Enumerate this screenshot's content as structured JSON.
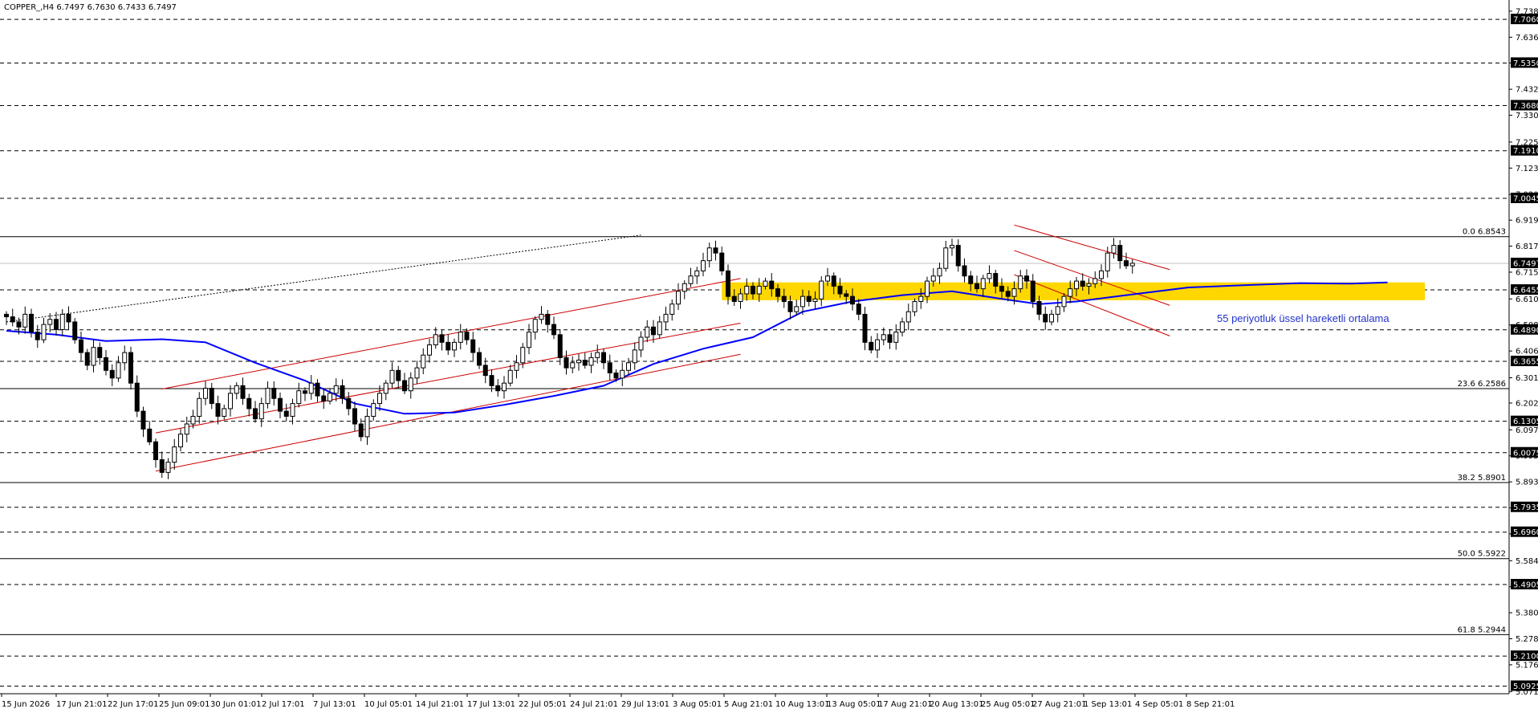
{
  "header": {
    "symbol_info": "COPPER_,H4  6.7497 6.7630 6.7433 6.7497"
  },
  "annotation": {
    "text": "55 periyotluk üssel hareketli ortalama",
    "color": "#2233cc"
  },
  "colors": {
    "candle": "#000000",
    "ema": "#0000ff",
    "channel": "#cc0000",
    "zone": "#ffd700",
    "hline": "#000000",
    "current_price_line": "#c0c0c0",
    "badge_bg": "#000000",
    "badge_text": "#ffffff"
  },
  "chart_data": {
    "type": "candlestick",
    "symbol": "COPPER_",
    "timeframe": "H4",
    "ohlc_header": {
      "open": 6.7497,
      "high": 6.763,
      "low": 6.7433,
      "close": 6.7497
    },
    "ylim": [
      5.0625,
      7.763
    ],
    "y_ticks": [
      "7.7380",
      "7.6360",
      "7.5350",
      "7.4320",
      "7.3300",
      "7.2250",
      "7.1230",
      "7.0200",
      "6.9190",
      "6.8170",
      "6.7150",
      "6.6100",
      "6.5080",
      "6.4060",
      "6.3010",
      "6.2020",
      "6.0970",
      "5.9950",
      "5.8930",
      "5.7910",
      "5.6890",
      "5.5840",
      "5.4820",
      "5.3800",
      "5.2780",
      "5.1760",
      "5.0710"
    ],
    "x_labels": [
      "15 Jun 2026",
      "17 Jun 21:01",
      "22 Jun 17:01",
      "25 Jun 09:01",
      "30 Jun 01:01",
      "2 Jul 17:01",
      "7 Jul 13:01",
      "10 Jul 05:01",
      "14 Jul 21:01",
      "17 Jul 13:01",
      "22 Jul 05:01",
      "24 Jul 21:01",
      "29 Jul 13:01",
      "3 Aug 05:01",
      "5 Aug 21:01",
      "10 Aug 13:01",
      "13 Aug 05:01",
      "17 Aug 21:01",
      "20 Aug 13:01",
      "25 Aug 05:01",
      "27 Aug 21:01",
      "1 Sep 13:01",
      "4 Sep 05:01",
      "8 Sep 21:01"
    ],
    "dashed_levels": [
      {
        "price": 7.706,
        "label": "7.7060"
      },
      {
        "price": 7.535,
        "label": "7.5350"
      },
      {
        "price": 7.368,
        "label": "7.3680"
      },
      {
        "price": 7.191,
        "label": "7.1910"
      },
      {
        "price": 7.0045,
        "label": "7.0045"
      },
      {
        "price": 6.6455,
        "label": "6.6455"
      },
      {
        "price": 6.489,
        "label": "6.4890"
      },
      {
        "price": 6.3655,
        "label": "6.3655"
      },
      {
        "price": 6.1305,
        "label": "6.1305"
      },
      {
        "price": 6.0075,
        "label": "6.0075"
      },
      {
        "price": 5.7935,
        "label": "5.7935"
      },
      {
        "price": 5.696,
        "label": "5.6960"
      },
      {
        "price": 5.4905,
        "label": "5.4905"
      },
      {
        "price": 5.21,
        "label": "5.2100"
      },
      {
        "price": 5.0925,
        "label": "5.0925"
      }
    ],
    "fibo_levels": [
      {
        "price": 6.8543,
        "label": "0.0 6.8543"
      },
      {
        "price": 6.2586,
        "label": "23.6 6.2586"
      },
      {
        "price": 5.8901,
        "label": "38.2 5.8901"
      },
      {
        "price": 5.5922,
        "label": "50.0 5.5922"
      },
      {
        "price": 5.2944,
        "label": "61.8 5.2944"
      }
    ],
    "current_price": {
      "price": 6.7497,
      "label": "6.7497"
    },
    "zone": {
      "top": 6.675,
      "bottom": 6.605,
      "from_bar": 115,
      "to_bar": 228
    },
    "ema_period": 55,
    "ema": [
      [
        0,
        6.485
      ],
      [
        8,
        6.47
      ],
      [
        16,
        6.445
      ],
      [
        25,
        6.452
      ],
      [
        32,
        6.44
      ],
      [
        40,
        6.36
      ],
      [
        48,
        6.29
      ],
      [
        56,
        6.2
      ],
      [
        64,
        6.16
      ],
      [
        72,
        6.165
      ],
      [
        80,
        6.195
      ],
      [
        88,
        6.23
      ],
      [
        96,
        6.27
      ],
      [
        104,
        6.355
      ],
      [
        112,
        6.415
      ],
      [
        120,
        6.46
      ],
      [
        128,
        6.56
      ],
      [
        136,
        6.6
      ],
      [
        144,
        6.625
      ],
      [
        152,
        6.64
      ],
      [
        160,
        6.61
      ],
      [
        166,
        6.59
      ],
      [
        172,
        6.6
      ],
      [
        180,
        6.625
      ],
      [
        190,
        6.655
      ],
      [
        200,
        6.665
      ],
      [
        208,
        6.672
      ],
      [
        216,
        6.67
      ],
      [
        222,
        6.675
      ]
    ],
    "candles_closes": [
      6.54,
      6.52,
      6.5,
      6.55,
      6.48,
      6.45,
      6.51,
      6.53,
      6.49,
      6.55,
      6.52,
      6.45,
      6.4,
      6.35,
      6.42,
      6.38,
      6.33,
      6.3,
      6.36,
      6.4,
      6.28,
      6.17,
      6.1,
      6.05,
      5.98,
      5.93,
      5.97,
      6.03,
      6.08,
      6.12,
      6.15,
      6.22,
      6.26,
      6.2,
      6.15,
      6.18,
      6.24,
      6.27,
      6.22,
      6.18,
      6.14,
      6.2,
      6.26,
      6.22,
      6.17,
      6.15,
      6.2,
      6.25,
      6.24,
      6.28,
      6.23,
      6.21,
      6.24,
      6.27,
      6.22,
      6.18,
      6.12,
      6.07,
      6.15,
      6.2,
      6.24,
      6.28,
      6.33,
      6.29,
      6.25,
      6.3,
      6.34,
      6.39,
      6.43,
      6.47,
      6.44,
      6.41,
      6.44,
      6.48,
      6.45,
      6.4,
      6.35,
      6.31,
      6.27,
      6.25,
      6.28,
      6.33,
      6.36,
      6.42,
      6.48,
      6.53,
      6.55,
      6.51,
      6.47,
      6.38,
      6.34,
      6.36,
      6.37,
      6.35,
      6.38,
      6.4,
      6.36,
      6.32,
      6.3,
      6.33,
      6.36,
      6.41,
      6.46,
      6.5,
      6.47,
      6.52,
      6.55,
      6.59,
      6.64,
      6.67,
      6.7,
      6.72,
      6.76,
      6.81,
      6.79,
      6.72,
      6.62,
      6.6,
      6.63,
      6.66,
      6.63,
      6.66,
      6.68,
      6.65,
      6.62,
      6.6,
      6.56,
      6.58,
      6.62,
      6.6,
      6.61,
      6.68,
      6.7,
      6.66,
      6.63,
      6.62,
      6.59,
      6.55,
      6.44,
      6.41,
      6.45,
      6.47,
      6.44,
      6.48,
      6.52,
      6.56,
      6.6,
      6.62,
      6.68,
      6.7,
      6.73,
      6.81,
      6.82,
      6.74,
      6.7,
      6.67,
      6.65,
      6.69,
      6.71,
      6.66,
      6.64,
      6.62,
      6.65,
      6.7,
      6.68,
      6.6,
      6.55,
      6.52,
      6.55,
      6.58,
      6.62,
      6.65,
      6.68,
      6.66,
      6.67,
      6.69,
      6.72,
      6.79,
      6.82,
      6.76,
      6.74,
      6.75
    ]
  }
}
